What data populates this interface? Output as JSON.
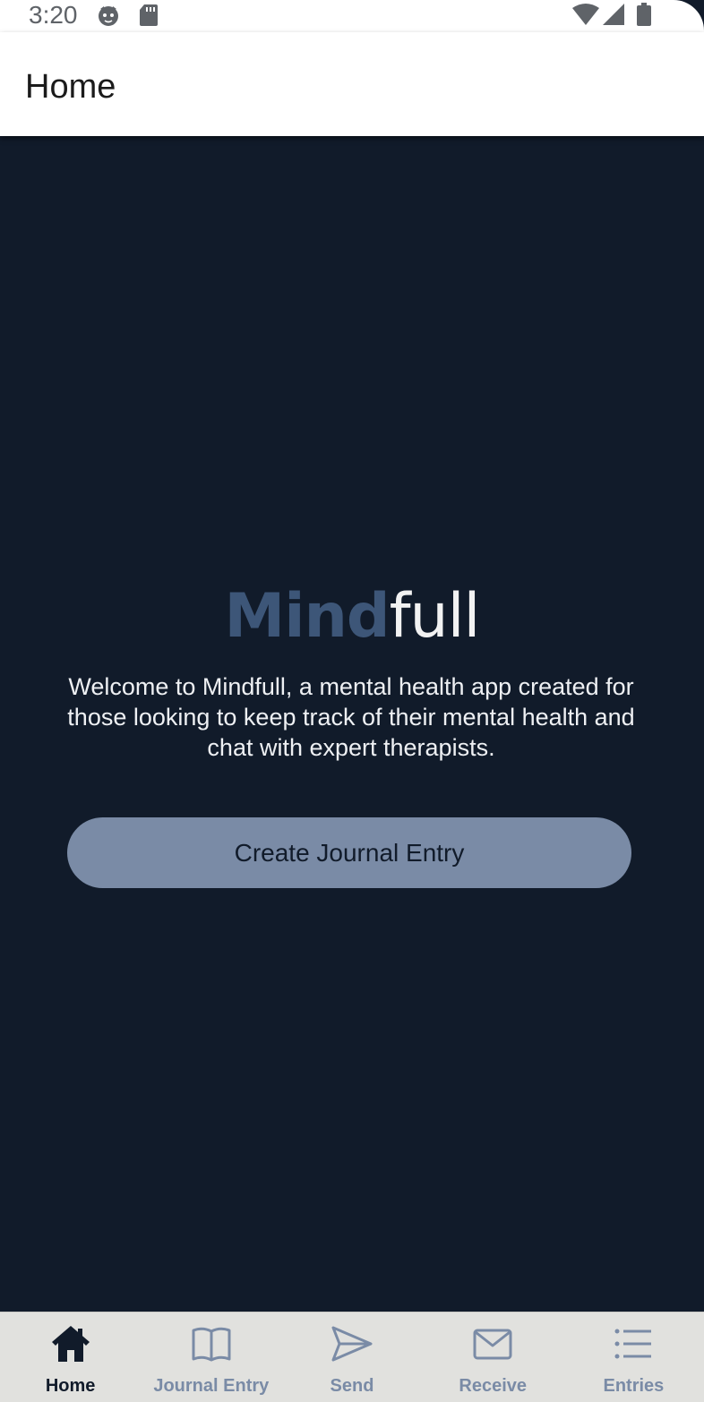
{
  "status_bar": {
    "time": "3:20",
    "icons": [
      "cat-face-icon",
      "sd-card-icon",
      "wifi-icon",
      "cell-signal-icon",
      "battery-icon"
    ]
  },
  "app_bar": {
    "title": "Home"
  },
  "main": {
    "logo": {
      "part1": "Mind",
      "part2": "full"
    },
    "welcome_text": "Welcome to Mindfull, a mental health app created for those looking to keep track of their mental health and chat with expert therapists.",
    "cta_label": "Create Journal Entry"
  },
  "bottom_nav": {
    "items": [
      {
        "label": "Home",
        "icon": "home-icon",
        "active": true
      },
      {
        "label": "Journal Entry",
        "icon": "book-icon",
        "active": false
      },
      {
        "label": "Send",
        "icon": "send-icon",
        "active": false
      },
      {
        "label": "Receive",
        "icon": "mail-icon",
        "active": false
      },
      {
        "label": "Entries",
        "icon": "list-icon",
        "active": false
      }
    ]
  },
  "colors": {
    "background": "#111b2a",
    "accent": "#7a8ba6",
    "logo_mind": "#3d5678",
    "nav_background": "#e1e1de"
  }
}
